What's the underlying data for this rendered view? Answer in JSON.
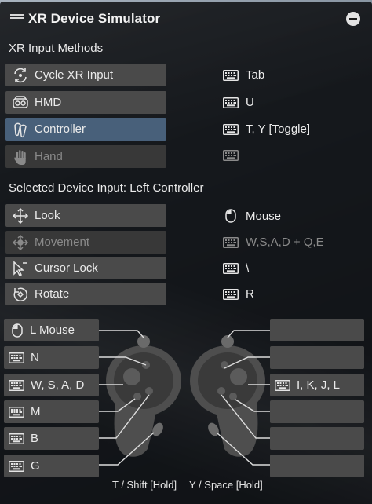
{
  "window": {
    "title": "XR Device Simulator"
  },
  "input_methods": {
    "heading": "XR Input Methods",
    "items": [
      {
        "label": "Cycle XR Input",
        "key": "Tab",
        "icon": "cycle-icon",
        "state": "normal"
      },
      {
        "label": "HMD",
        "key": "U",
        "icon": "hmd-icon",
        "state": "normal"
      },
      {
        "label": "Controller",
        "key": "T, Y [Toggle]",
        "icon": "controller-icon",
        "state": "selected"
      },
      {
        "label": "Hand",
        "key": "",
        "icon": "hand-icon",
        "state": "disabled"
      }
    ]
  },
  "device_input": {
    "heading": "Selected Device Input: Left Controller",
    "items": [
      {
        "label": "Look",
        "key": "Mouse",
        "icon": "move-arrows-icon",
        "key_icon": "mouse-icon",
        "state": "normal"
      },
      {
        "label": "Movement",
        "key": "W,S,A,D + Q,E",
        "icon": "move-arrows-icon",
        "key_icon": "keyboard-icon",
        "state": "disabled"
      },
      {
        "label": "Cursor Lock",
        "key": "\\",
        "icon": "cursor-icon",
        "key_icon": "keyboard-icon",
        "state": "normal"
      },
      {
        "label": "Rotate",
        "key": "R",
        "icon": "rotate-icon",
        "key_icon": "keyboard-icon",
        "state": "normal"
      }
    ]
  },
  "controller_map": {
    "left_bindings": [
      {
        "label": "L Mouse",
        "icon": "mouse-icon"
      },
      {
        "label": "N",
        "icon": "keyboard-icon"
      },
      {
        "label": "W, S, A, D",
        "icon": "keyboard-icon"
      },
      {
        "label": "M",
        "icon": "keyboard-icon"
      },
      {
        "label": "B",
        "icon": "keyboard-icon"
      },
      {
        "label": "G",
        "icon": "keyboard-icon"
      }
    ],
    "right_bindings": [
      {
        "label": ""
      },
      {
        "label": ""
      },
      {
        "label": "I, K, J, L",
        "icon": "keyboard-icon"
      },
      {
        "label": ""
      },
      {
        "label": ""
      },
      {
        "label": ""
      }
    ],
    "left_hint": "T / Shift [Hold]",
    "right_hint": "Y / Space [Hold]"
  },
  "colors": {
    "panel": "#0e1013",
    "button": "#4a4a4a",
    "button_selected": "#48607a",
    "button_disabled": "#383838",
    "text": "#ececec",
    "text_disabled": "#8a8a8a"
  }
}
